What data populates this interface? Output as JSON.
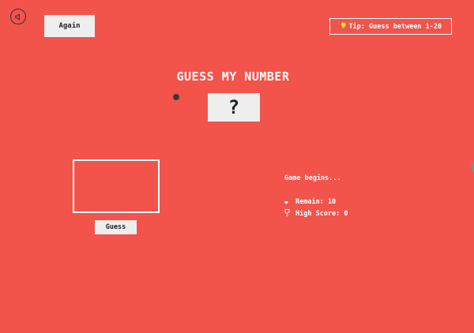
{
  "header": {
    "sound_icon": "speaker-icon",
    "again_label": "Again",
    "tip_icon": "lightbulb-icon",
    "tip_text": "Tip: Guess between 1-20"
  },
  "main": {
    "title": "GUESS MY NUMBER",
    "secret_display": "?"
  },
  "input": {
    "value": "",
    "guess_label": "Guess"
  },
  "status": {
    "message": "Game begins...",
    "remain_icon": "heart-icon",
    "remain_label": "Remain: 10",
    "high_score_icon": "trophy-icon",
    "high_score_label": "High Score: 0"
  },
  "colors": {
    "background": "#f2544c",
    "button_bg": "#eeeeee",
    "text": "#ffffff"
  }
}
